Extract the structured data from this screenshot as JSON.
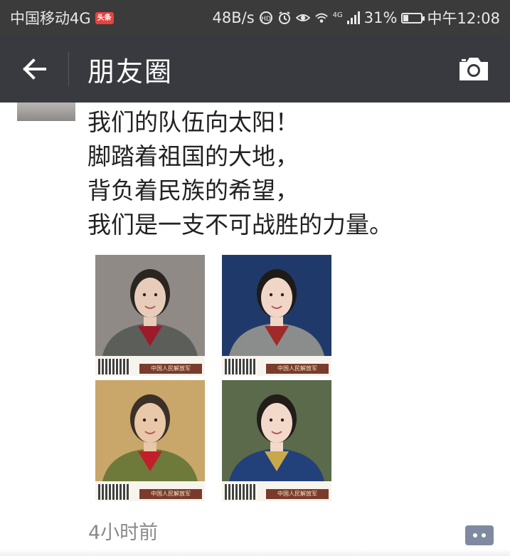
{
  "status_bar": {
    "carrier": "中国移动4G",
    "news_badge": "头条",
    "net_speed": "48B/s",
    "network_type": "4G",
    "battery": "31%",
    "battery_level": 0.31,
    "time": "中午12:08",
    "icons": [
      "hd-icon",
      "alarm-icon",
      "eye-icon",
      "wifi-icon",
      "signal-icon",
      "battery-icon"
    ]
  },
  "header": {
    "title": "朋友圈",
    "back_icon": "arrow-left-icon",
    "camera_icon": "camera-icon"
  },
  "post": {
    "lines": [
      "我们的队伍向太阳！",
      "脚踏着祖国的大地，",
      "背负着民族的希望，",
      "我们是一支不可战胜的力量。"
    ],
    "photos": [
      {
        "caption": "中国人民解放军",
        "palette": {
          "bg": "#8f8a86",
          "skin": "#e7cdb9",
          "hair": "#2b2522",
          "uniform": "#5c5e5a",
          "accent": "#9b1b2a"
        }
      },
      {
        "caption": "中国人民解放军",
        "palette": {
          "bg": "#1f3a6a",
          "skin": "#f0d6c6",
          "hair": "#1e1a18",
          "uniform": "#8a8d8c",
          "accent": "#a02a2a"
        }
      },
      {
        "caption": "中国人民解放军",
        "palette": {
          "bg": "#c9a66a",
          "skin": "#e8c8a8",
          "hair": "#3a3028",
          "uniform": "#6d7a3a",
          "accent": "#c21f2a"
        }
      },
      {
        "caption": "中国人民解放军",
        "palette": {
          "bg": "#5a6a4a",
          "skin": "#f2d9c9",
          "hair": "#221c1a",
          "uniform": "#22407a",
          "accent": "#c8a84a"
        }
      }
    ],
    "timestamp": "4小时前",
    "comment_icon": "comment-dots-icon"
  }
}
